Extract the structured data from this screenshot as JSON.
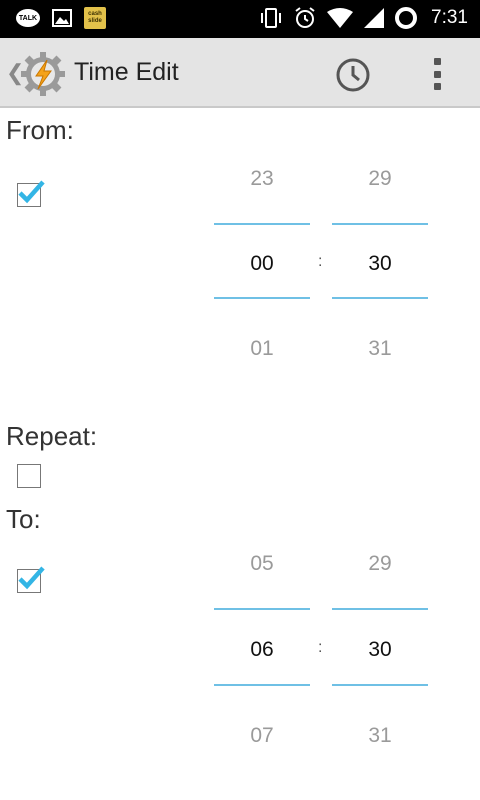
{
  "statusbar": {
    "notif_talk_label": "TALK",
    "notif_cashslide_label": "cash slide",
    "time": "7:31"
  },
  "actionbar": {
    "title": "Time Edit"
  },
  "from": {
    "label": "From:",
    "checked": true,
    "hour_above": "23",
    "hour_selected": "00",
    "hour_below": "01",
    "minute_above": "29",
    "minute_selected": "30",
    "minute_below": "31",
    "separator": ":"
  },
  "repeat": {
    "label": "Repeat:",
    "checked": false
  },
  "to": {
    "label": "To:",
    "checked": true,
    "hour_above": "05",
    "hour_selected": "06",
    "hour_below": "07",
    "minute_above": "29",
    "minute_selected": "30",
    "minute_below": "31",
    "separator": ":"
  },
  "colors": {
    "accent": "#33b5e5",
    "picker_divider": "#6fc0e5",
    "actionbar_bg": "#e4e4e4"
  }
}
